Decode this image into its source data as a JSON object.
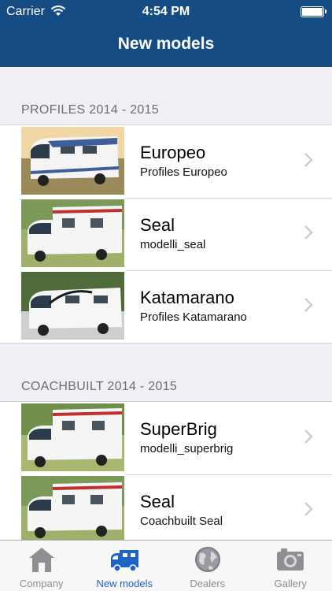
{
  "status_bar": {
    "carrier": "Carrier",
    "time": "4:54 PM"
  },
  "nav": {
    "title": "New models"
  },
  "sections": [
    {
      "header": "PROFILES 2014 - 2015",
      "items": [
        {
          "title": "Europeo",
          "subtitle": "Profiles Europeo"
        },
        {
          "title": "Seal",
          "subtitle": "modelli_seal"
        },
        {
          "title": "Katamarano",
          "subtitle": "Profiles Katamarano"
        }
      ]
    },
    {
      "header": "COACHBUILT 2014 - 2015",
      "items": [
        {
          "title": "SuperBrig",
          "subtitle": "modelli_superbrig"
        },
        {
          "title": "Seal",
          "subtitle": "Coachbuilt Seal"
        }
      ]
    }
  ],
  "tab_bar": {
    "tabs": [
      {
        "label": "Company",
        "icon": "house-icon"
      },
      {
        "label": "New models",
        "icon": "camper-icon",
        "active": true
      },
      {
        "label": "Dealers",
        "icon": "globe-icon"
      },
      {
        "label": "Gallery",
        "icon": "camera-icon"
      }
    ]
  },
  "colors": {
    "nav_bar": "#164c84",
    "tab_active": "#1e63c4",
    "tab_inactive": "#8e8e93"
  }
}
